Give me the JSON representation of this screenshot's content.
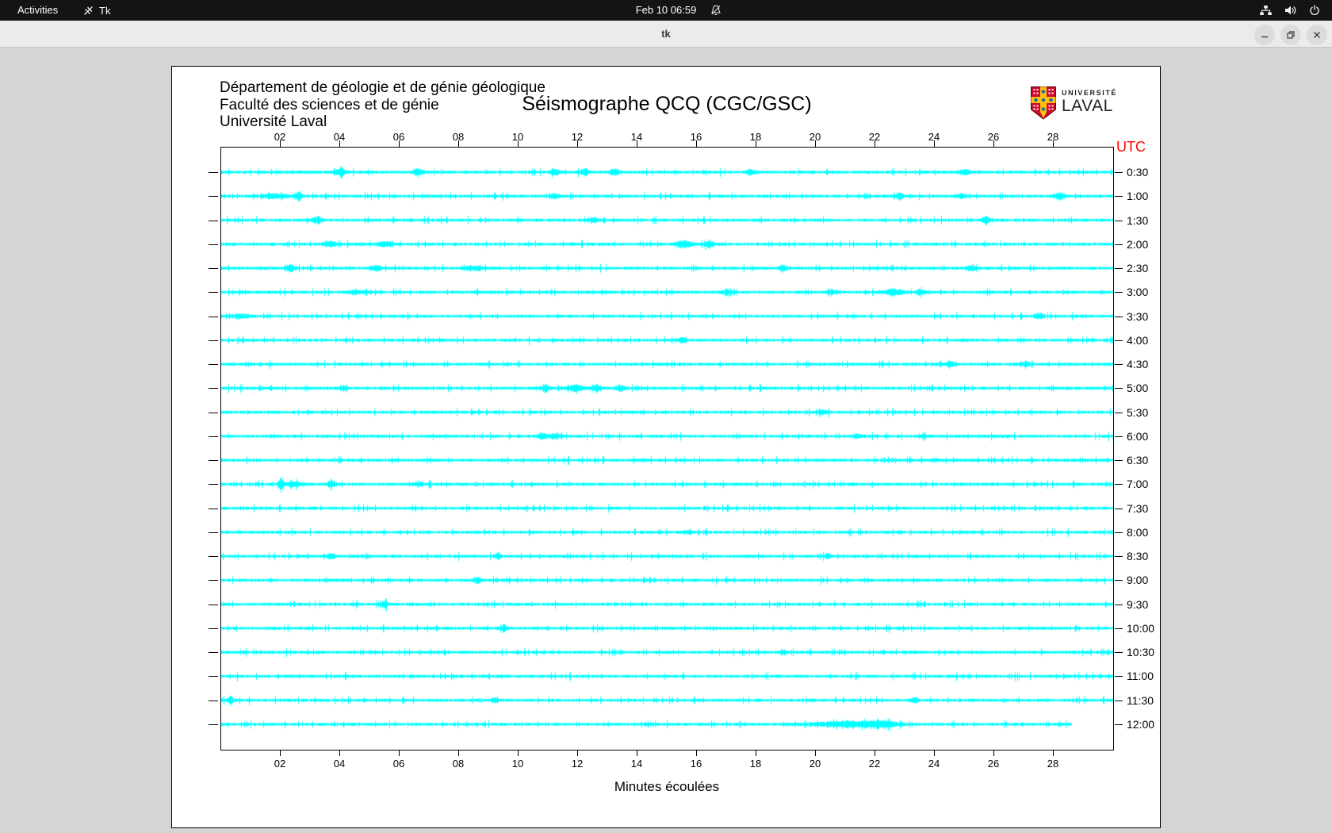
{
  "topbar": {
    "activities": "Activities",
    "app_name": "Tk",
    "clock": "Feb 10 06:59"
  },
  "titlebar": {
    "title": "tk"
  },
  "page": {
    "header_lines": "Département de géologie et de génie géologique\nFaculté des sciences et de génie\nUniversité Laval",
    "title": "Séismographe QCQ (CGC/GSC)",
    "logo_line1": "UNIVERSITÉ",
    "logo_line2": "LAVAL",
    "utc_label": "UTC",
    "xlabel": "Minutes écoulées"
  },
  "colors": {
    "trace": "#00ffff",
    "utc_label": "#ff0000",
    "page_bg": "#ffffff",
    "window_bg": "#d5d5d5",
    "topbar_bg": "#141414",
    "titlebar_bg": "#ebebeb",
    "logo_red": "#cf0a2c",
    "logo_gold": "#ffc20e",
    "logo_blue": "#1f6fb4"
  },
  "chart_data": {
    "type": "line",
    "title": "Séismographe QCQ (CGC/GSC)",
    "xlabel": "Minutes écoulées",
    "right_axis_label": "UTC",
    "x_range_minutes": [
      0,
      30
    ],
    "x_ticks": [
      "02",
      "04",
      "06",
      "08",
      "10",
      "12",
      "14",
      "16",
      "18",
      "20",
      "22",
      "24",
      "26",
      "28"
    ],
    "row_spacing_minutes": 30,
    "rows": [
      {
        "label": "0:30",
        "events": [
          [
            4.0,
            6,
            4
          ],
          [
            6.6,
            5,
            4
          ],
          [
            11.2,
            3,
            4
          ],
          [
            12.2,
            4,
            4
          ],
          [
            13.2,
            4,
            4
          ],
          [
            17.8,
            3,
            4
          ],
          [
            25.0,
            3,
            5
          ]
        ]
      },
      {
        "label": "1:00",
        "events": [
          [
            1.8,
            3,
            10
          ],
          [
            2.6,
            5,
            3
          ],
          [
            11.2,
            3,
            4
          ],
          [
            22.8,
            3,
            4
          ],
          [
            24.9,
            3,
            4
          ],
          [
            28.2,
            4,
            5
          ]
        ]
      },
      {
        "label": "1:30",
        "events": [
          [
            3.2,
            4,
            5
          ],
          [
            12.5,
            4,
            4
          ],
          [
            25.7,
            4,
            4
          ]
        ]
      },
      {
        "label": "2:00",
        "events": [
          [
            3.6,
            4,
            5
          ],
          [
            5.5,
            3,
            6
          ],
          [
            15.5,
            4,
            8
          ],
          [
            16.4,
            4,
            4
          ]
        ]
      },
      {
        "label": "2:30",
        "events": [
          [
            2.3,
            4,
            4
          ],
          [
            5.2,
            3,
            5
          ],
          [
            8.5,
            3,
            8
          ],
          [
            18.9,
            3,
            4
          ],
          [
            25.2,
            3,
            4
          ]
        ]
      },
      {
        "label": "3:00",
        "events": [
          [
            4.6,
            2,
            10
          ],
          [
            17.0,
            3,
            4
          ],
          [
            20.5,
            3,
            4
          ],
          [
            22.6,
            4,
            8
          ],
          [
            23.5,
            3,
            4
          ]
        ]
      },
      {
        "label": "3:30",
        "events": [
          [
            0.6,
            2,
            10
          ],
          [
            27.5,
            4,
            4
          ]
        ]
      },
      {
        "label": "4:00",
        "events": [
          [
            15.5,
            3,
            4
          ]
        ]
      },
      {
        "label": "4:30",
        "events": [
          [
            24.5,
            3,
            4
          ],
          [
            27.0,
            3,
            4
          ]
        ]
      },
      {
        "label": "5:00",
        "events": [
          [
            4.1,
            3,
            3
          ],
          [
            10.9,
            3,
            5
          ],
          [
            11.9,
            4,
            7
          ],
          [
            12.6,
            4,
            5
          ],
          [
            13.4,
            4,
            4
          ]
        ]
      },
      {
        "label": "5:30",
        "events": [
          [
            20.2,
            2,
            4
          ]
        ]
      },
      {
        "label": "6:00",
        "events": [
          [
            10.8,
            6,
            3
          ],
          [
            11.2,
            3,
            5
          ],
          [
            21.4,
            2,
            4
          ],
          [
            23.6,
            2,
            4
          ]
        ]
      },
      {
        "label": "6:30",
        "events": [
          [
            24.0,
            1.5,
            4
          ]
        ]
      },
      {
        "label": "7:00",
        "events": [
          [
            2.0,
            7,
            2
          ],
          [
            2.4,
            4,
            6
          ],
          [
            3.7,
            6,
            3
          ],
          [
            6.6,
            2,
            5
          ]
        ]
      },
      {
        "label": "7:30",
        "events": []
      },
      {
        "label": "8:00",
        "events": [
          [
            15.7,
            3,
            3
          ]
        ]
      },
      {
        "label": "8:30",
        "events": [
          [
            3.7,
            4,
            3
          ],
          [
            9.3,
            4,
            3
          ],
          [
            20.4,
            3,
            3
          ]
        ]
      },
      {
        "label": "9:00",
        "events": [
          [
            8.6,
            3,
            3
          ]
        ]
      },
      {
        "label": "9:30",
        "events": [
          [
            5.5,
            3,
            3
          ]
        ]
      },
      {
        "label": "10:00",
        "events": [
          [
            9.5,
            4,
            3
          ]
        ]
      },
      {
        "label": "10:30",
        "events": [
          [
            18.9,
            2,
            3
          ]
        ]
      },
      {
        "label": "11:00",
        "events": []
      },
      {
        "label": "11:30",
        "events": [
          [
            0.3,
            4,
            3
          ],
          [
            9.2,
            3,
            3
          ],
          [
            23.3,
            3,
            3
          ]
        ]
      },
      {
        "label": "12:00",
        "events": [
          [
            20.5,
            2,
            25
          ],
          [
            21.5,
            3,
            20
          ],
          [
            22.3,
            3,
            15
          ]
        ],
        "end_minute": 28.6
      }
    ]
  }
}
